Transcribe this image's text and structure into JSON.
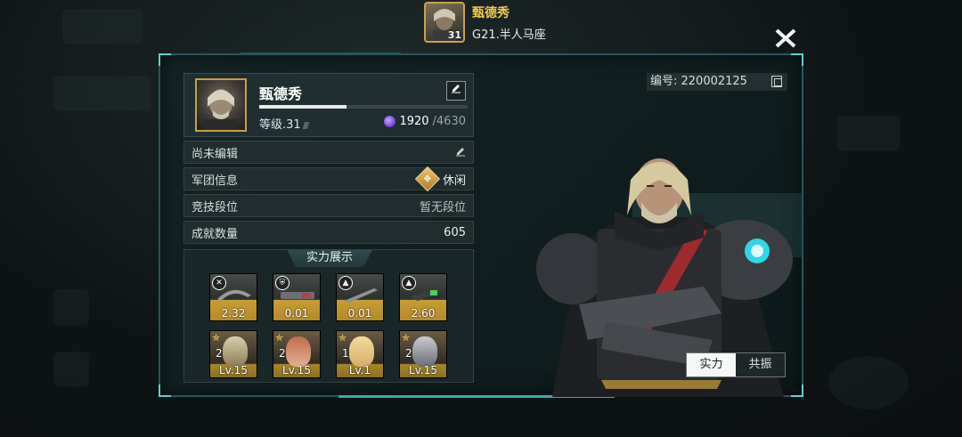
{
  "top": {
    "name": "甄德秀",
    "server": "G21.半人马座",
    "avatar_level": "31"
  },
  "profile": {
    "name": "甄德秀",
    "level_label": "等级.31",
    "xp_fraction": 0.42,
    "energy_current": "1920",
    "energy_max": "/4630",
    "uid": "编号: 220002125"
  },
  "info": [
    {
      "label": "尚未编辑",
      "value": ""
    },
    {
      "label": "军团信息",
      "value": "休闲"
    },
    {
      "label": "竞技段位",
      "value": "暂无段位"
    },
    {
      "label": "成就数量",
      "value": "605"
    }
  ],
  "showcase": {
    "title": "实力展示",
    "equipment": [
      {
        "icon": "crosshair-icon",
        "value": "2.32"
      },
      {
        "icon": "shield-icon",
        "value": "0.01"
      },
      {
        "icon": "upgrade-icon",
        "value": "0.01"
      },
      {
        "icon": "upgrade-icon",
        "value": "2.60"
      }
    ],
    "heroes": [
      {
        "stars": "2",
        "level": "Lv.15"
      },
      {
        "stars": "2",
        "level": "Lv.15"
      },
      {
        "stars": "1",
        "level": "Lv.1"
      },
      {
        "stars": "2",
        "level": "Lv.15"
      }
    ]
  },
  "toggle": {
    "active": "实力",
    "inactive": "共振"
  },
  "colors": {
    "gold": "#c79f46",
    "accent_teal": "#3aa8ad",
    "name_yellow": "#f2c94c"
  }
}
